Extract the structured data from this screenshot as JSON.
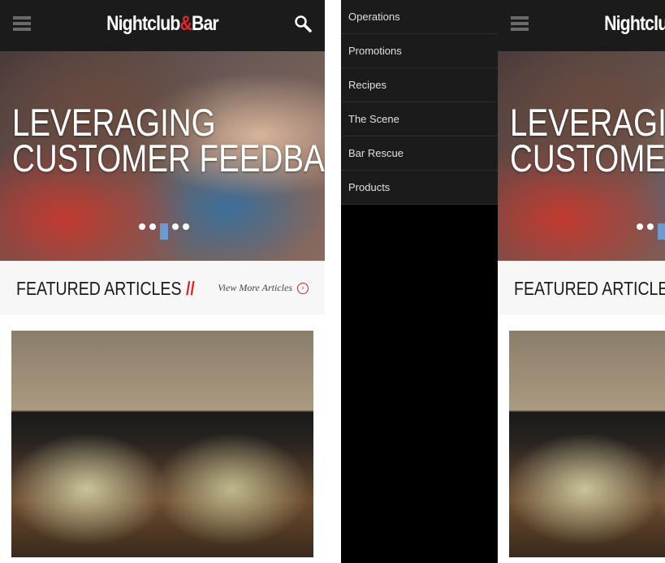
{
  "header": {
    "logo_pre": "Nightclub",
    "logo_amp": "&",
    "logo_post": "Bar"
  },
  "hero": {
    "title_line1": "LEVERAGING",
    "title_line2": "CUSTOMER FEEDBACK",
    "slide_count": 5,
    "active_slide": 3
  },
  "featured": {
    "title": "FEATURED ARTICLES",
    "slashes": "//",
    "view_more": "View More Articles",
    "more_icon": "›"
  },
  "menu": {
    "items": [
      {
        "label": "Operations"
      },
      {
        "label": "Promotions"
      },
      {
        "label": "Recipes"
      },
      {
        "label": "The Scene"
      },
      {
        "label": "Bar Rescue"
      },
      {
        "label": "Products"
      }
    ]
  },
  "colors": {
    "accent": "#d6262b",
    "header_bg": "#1b1b1b",
    "active_dot": "#6e9ad0"
  }
}
